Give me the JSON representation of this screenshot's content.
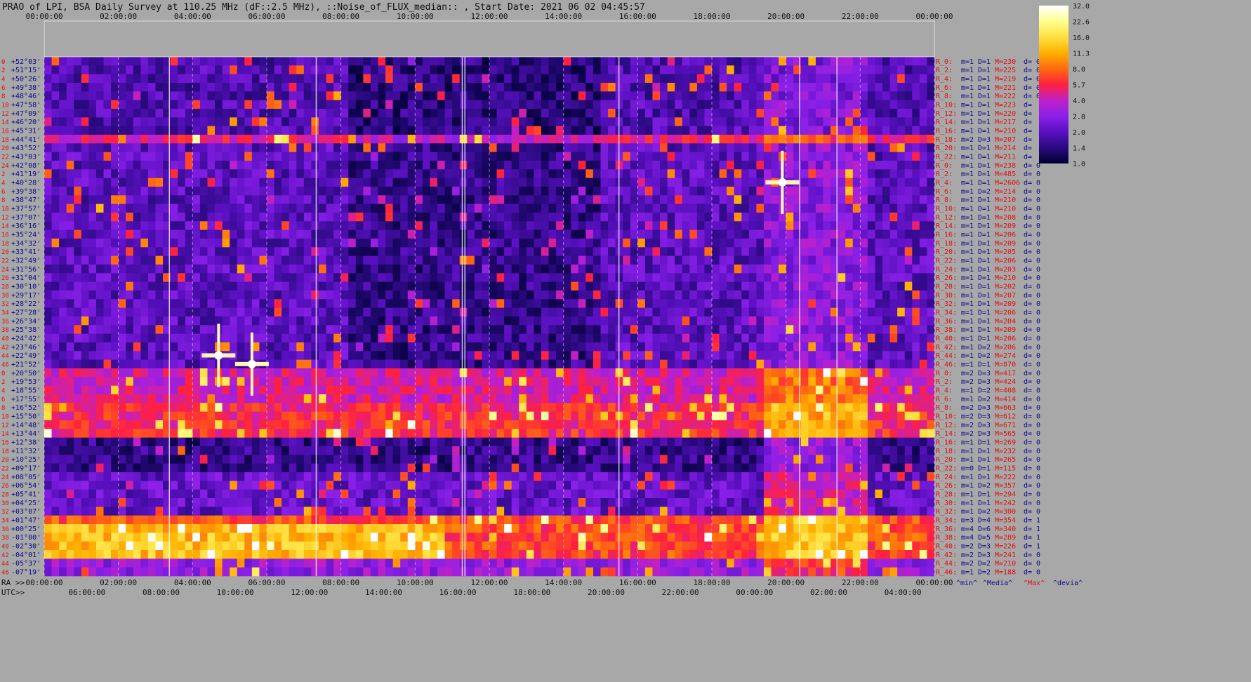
{
  "chart_data": {
    "type": "heatmap",
    "title": "PRAO of LPI, BSA Daily Survey at 110.25 MHz (dF::2.5 MHz), ::Noise_of_FLUX_median:: , Start Date: 2021 06 02 04:45:57",
    "x_top_ticks": [
      "00:00:00",
      "02:00:00",
      "04:00:00",
      "06:00:00",
      "08:00:00",
      "10:00:00",
      "12:00:00",
      "14:00:00",
      "16:00:00",
      "18:00:00",
      "20:00:00",
      "22:00:00",
      "00:00:00"
    ],
    "x_ra_prefix": "RA >>",
    "x_ra_ticks": [
      "00:00:00",
      "02:00:00",
      "04:00:00",
      "06:00:00",
      "08:00:00",
      "10:00:00",
      "12:00:00",
      "14:00:00",
      "16:00:00",
      "18:00:00",
      "20:00:00",
      "22:00:00",
      "00:00:00"
    ],
    "x_utc_prefix": "UTC>>",
    "x_utc_ticks": [
      "06:00:00",
      "08:00:00",
      "10:00:00",
      "12:00:00",
      "14:00:00",
      "16:00:00",
      "18:00:00",
      "20:00:00",
      "22:00:00",
      "00:00:00",
      "02:00:00",
      "04:00:00"
    ],
    "y_ticks": [
      {
        "n": "0",
        "dec": "+52°03'"
      },
      {
        "n": "2",
        "dec": "+51°15'"
      },
      {
        "n": "4",
        "dec": "+50°26'"
      },
      {
        "n": "6",
        "dec": "+49°38'"
      },
      {
        "n": "8",
        "dec": "+48°46'"
      },
      {
        "n": "10",
        "dec": "+47°58'"
      },
      {
        "n": "12",
        "dec": "+47°09'"
      },
      {
        "n": "14",
        "dec": "+46°20'"
      },
      {
        "n": "16",
        "dec": "+45°31'"
      },
      {
        "n": "18",
        "dec": "+44°41'"
      },
      {
        "n": "20",
        "dec": "+43°52'"
      },
      {
        "n": "22",
        "dec": "+43°03'"
      },
      {
        "n": "24",
        "dec": "+42°08'"
      },
      {
        "n": "2",
        "dec": "+41°19'"
      },
      {
        "n": "4",
        "dec": "+40°28'"
      },
      {
        "n": "6",
        "dec": "+39°38'"
      },
      {
        "n": "8",
        "dec": "+38°47'"
      },
      {
        "n": "10",
        "dec": "+37°57'"
      },
      {
        "n": "12",
        "dec": "+37°07'"
      },
      {
        "n": "14",
        "dec": "+36°16'"
      },
      {
        "n": "16",
        "dec": "+35°24'"
      },
      {
        "n": "18",
        "dec": "+34°32'"
      },
      {
        "n": "20",
        "dec": "+33°41'"
      },
      {
        "n": "22",
        "dec": "+32°49'"
      },
      {
        "n": "24",
        "dec": "+31°56'"
      },
      {
        "n": "26",
        "dec": "+31°04'"
      },
      {
        "n": "28",
        "dec": "+30°10'"
      },
      {
        "n": "30",
        "dec": "+29°17'"
      },
      {
        "n": "32",
        "dec": "+28°22'"
      },
      {
        "n": "34",
        "dec": "+27°28'"
      },
      {
        "n": "36",
        "dec": "+26°34'"
      },
      {
        "n": "38",
        "dec": "+25°38'"
      },
      {
        "n": "40",
        "dec": "+24°42'"
      },
      {
        "n": "42",
        "dec": "+23°46'"
      },
      {
        "n": "44",
        "dec": "+22°49'"
      },
      {
        "n": "46",
        "dec": "+21°52'"
      },
      {
        "n": "0",
        "dec": "+20°50'"
      },
      {
        "n": "2",
        "dec": "+19°53'"
      },
      {
        "n": "4",
        "dec": "+18°55'"
      },
      {
        "n": "6",
        "dec": "+17°55'"
      },
      {
        "n": "8",
        "dec": "+16°52'"
      },
      {
        "n": "10",
        "dec": "+15°50'"
      },
      {
        "n": "12",
        "dec": "+14°48'"
      },
      {
        "n": "14",
        "dec": "+13°44'"
      },
      {
        "n": "16",
        "dec": "+12°38'"
      },
      {
        "n": "18",
        "dec": "+11°32'"
      },
      {
        "n": "20",
        "dec": "+10°25'"
      },
      {
        "n": "22",
        "dec": "+09°17'"
      },
      {
        "n": "24",
        "dec": "+08°05'"
      },
      {
        "n": "26",
        "dec": "+06°54'"
      },
      {
        "n": "28",
        "dec": "+05°41'"
      },
      {
        "n": "30",
        "dec": "+04°25'"
      },
      {
        "n": "32",
        "dec": "+03°07'"
      },
      {
        "n": "34",
        "dec": "+01°47'"
      },
      {
        "n": "36",
        "dec": "+00°25'"
      },
      {
        "n": "38",
        "dec": "-01°00'"
      },
      {
        "n": "40",
        "dec": "-02°30'"
      },
      {
        "n": "42",
        "dec": "-04°01'"
      },
      {
        "n": "44",
        "dec": "-05°37'"
      },
      {
        "n": "46",
        "dec": "-07°19'"
      }
    ],
    "right_rows": [
      {
        "r": "R_0:",
        "m": "m=1",
        "D": "D=1",
        "M": "M=230",
        "d": "d= 0"
      },
      {
        "r": "R_2:",
        "m": "m=1",
        "D": "D=1",
        "M": "M=225",
        "d": "d= 0"
      },
      {
        "r": "R_4:",
        "m": "m=1",
        "D": "D=1",
        "M": "M=219",
        "d": "d= 0"
      },
      {
        "r": "R_6:",
        "m": "m=1",
        "D": "D=1",
        "M": "M=221",
        "d": "d= 0"
      },
      {
        "r": "R_8:",
        "m": "m=1",
        "D": "D=1",
        "M": "M=222",
        "d": "d= 0"
      },
      {
        "r": "R_10:",
        "m": "m=1",
        "D": "D=1",
        "M": "M=223",
        "d": "d="
      },
      {
        "r": "R_12:",
        "m": "m=1",
        "D": "D=1",
        "M": "M=220",
        "d": "d="
      },
      {
        "r": "R_14:",
        "m": "m=1",
        "D": "D=1",
        "M": "M=217",
        "d": "d="
      },
      {
        "r": "R_16:",
        "m": "m=1",
        "D": "D=1",
        "M": "M=210",
        "d": "d="
      },
      {
        "r": "R_18:",
        "m": "m=2",
        "D": "D=3",
        "M": "M=207",
        "d": "d="
      },
      {
        "r": "R_20:",
        "m": "m=1",
        "D": "D=1",
        "M": "M=214",
        "d": "d="
      },
      {
        "r": "R_22:",
        "m": "m=1",
        "D": "D=1",
        "M": "M=211",
        "d": "d="
      },
      {
        "r": "R_0:",
        "m": "m=1",
        "D": "D=1",
        "M": "M=238",
        "d": "d= 0"
      },
      {
        "r": "R_2:",
        "m": "m=1",
        "D": "D=1",
        "M": "M=485",
        "d": "d= 0"
      },
      {
        "r": "R_4:",
        "m": "m=1",
        "D": "D=1",
        "M": "M=2606",
        "d": "d= 0"
      },
      {
        "r": "R_6:",
        "m": "m=1",
        "D": "D=2",
        "M": "M=214",
        "d": "d= 0"
      },
      {
        "r": "R_8:",
        "m": "m=1",
        "D": "D=1",
        "M": "M=210",
        "d": "d= 0"
      },
      {
        "r": "R_10:",
        "m": "m=1",
        "D": "D=1",
        "M": "M=210",
        "d": "d= 0"
      },
      {
        "r": "R_12:",
        "m": "m=1",
        "D": "D=1",
        "M": "M=208",
        "d": "d= 0"
      },
      {
        "r": "R_14:",
        "m": "m=1",
        "D": "D=1",
        "M": "M=209",
        "d": "d= 0"
      },
      {
        "r": "R_16:",
        "m": "m=1",
        "D": "D=1",
        "M": "M=206",
        "d": "d= 0"
      },
      {
        "r": "R_18:",
        "m": "m=1",
        "D": "D=1",
        "M": "M=209",
        "d": "d= 0"
      },
      {
        "r": "R_20:",
        "m": "m=1",
        "D": "D=1",
        "M": "M=205",
        "d": "d= 0"
      },
      {
        "r": "R_22:",
        "m": "m=1",
        "D": "D=1",
        "M": "M=206",
        "d": "d= 0"
      },
      {
        "r": "R_24:",
        "m": "m=1",
        "D": "D=1",
        "M": "M=203",
        "d": "d= 0"
      },
      {
        "r": "R_26:",
        "m": "m=1",
        "D": "D=1",
        "M": "M=210",
        "d": "d= 0"
      },
      {
        "r": "R_28:",
        "m": "m=1",
        "D": "D=1",
        "M": "M=202",
        "d": "d= 0"
      },
      {
        "r": "R_30:",
        "m": "m=1",
        "D": "D=1",
        "M": "M=207",
        "d": "d= 0"
      },
      {
        "r": "R_32:",
        "m": "m=1",
        "D": "D=1",
        "M": "M=209",
        "d": "d= 0"
      },
      {
        "r": "R_34:",
        "m": "m=1",
        "D": "D=1",
        "M": "M=206",
        "d": "d= 0"
      },
      {
        "r": "R_36:",
        "m": "m=1",
        "D": "D=1",
        "M": "M=204",
        "d": "d= 0"
      },
      {
        "r": "R_38:",
        "m": "m=1",
        "D": "D=1",
        "M": "M=209",
        "d": "d= 0"
      },
      {
        "r": "R_40:",
        "m": "m=1",
        "D": "D=1",
        "M": "M=206",
        "d": "d= 0"
      },
      {
        "r": "R_42:",
        "m": "m=1",
        "D": "D=2",
        "M": "M=206",
        "d": "d= 0"
      },
      {
        "r": "R_44:",
        "m": "m=1",
        "D": "D=2",
        "M": "M=274",
        "d": "d= 0"
      },
      {
        "r": "R_46:",
        "m": "m=1",
        "D": "D=1",
        "M": "M=870",
        "d": "d= 0"
      },
      {
        "r": "R_0:",
        "m": "m=2",
        "D": "D=3",
        "M": "M=417",
        "d": "d= 0"
      },
      {
        "r": "R_2:",
        "m": "m=2",
        "D": "D=3",
        "M": "M=424",
        "d": "d= 0"
      },
      {
        "r": "R_4:",
        "m": "m=1",
        "D": "D=2",
        "M": "M=408",
        "d": "d= 0"
      },
      {
        "r": "R_6:",
        "m": "m=1",
        "D": "D=2",
        "M": "M=414",
        "d": "d= 0"
      },
      {
        "r": "R_8:",
        "m": "m=2",
        "D": "D=3",
        "M": "M=663",
        "d": "d= 0"
      },
      {
        "r": "R_10:",
        "m": "m=2",
        "D": "D=3",
        "M": "M=612",
        "d": "d= 0"
      },
      {
        "r": "R_12:",
        "m": "m=2",
        "D": "D=3",
        "M": "M=671",
        "d": "d= 0"
      },
      {
        "r": "R_14:",
        "m": "m=2",
        "D": "D=3",
        "M": "M=565",
        "d": "d= 0"
      },
      {
        "r": "R_16:",
        "m": "m=1",
        "D": "D=1",
        "M": "M=269",
        "d": "d= 0"
      },
      {
        "r": "R_18:",
        "m": "m=1",
        "D": "D=1",
        "M": "M=232",
        "d": "d= 0"
      },
      {
        "r": "R_20:",
        "m": "m=1",
        "D": "D=1",
        "M": "M=265",
        "d": "d= 0"
      },
      {
        "r": "R_22:",
        "m": "m=0",
        "D": "D=1",
        "M": "M=115",
        "d": "d= 0"
      },
      {
        "r": "R_24:",
        "m": "m=1",
        "D": "D=1",
        "M": "M=222",
        "d": "d= 0"
      },
      {
        "r": "R_26:",
        "m": "m=1",
        "D": "D=2",
        "M": "M=357",
        "d": "d= 0"
      },
      {
        "r": "R_28:",
        "m": "m=1",
        "D": "D=1",
        "M": "M=294",
        "d": "d= 0"
      },
      {
        "r": "R_30:",
        "m": "m=1",
        "D": "D=1",
        "M": "M=242",
        "d": "d= 0"
      },
      {
        "r": "R_32:",
        "m": "m=1",
        "D": "D=2",
        "M": "M=300",
        "d": "d= 0"
      },
      {
        "r": "R_34:",
        "m": "m=3",
        "D": "D=4",
        "M": "M=354",
        "d": "d= 1"
      },
      {
        "r": "R_36:",
        "m": "m=4",
        "D": "D=6",
        "M": "M=340",
        "d": "d= 1"
      },
      {
        "r": "R_38:",
        "m": "m=4",
        "D": "D=5",
        "M": "M=289",
        "d": "d= 1"
      },
      {
        "r": "R_40:",
        "m": "m=2",
        "D": "D=3",
        "M": "M=226",
        "d": "d= 1"
      },
      {
        "r": "R_42:",
        "m": "m=2",
        "D": "D=3",
        "M": "M=241",
        "d": "d= 0"
      },
      {
        "r": "R_44:",
        "m": "m=2",
        "D": "D=2",
        "M": "M=210",
        "d": "d= 0"
      },
      {
        "r": "R_46:",
        "m": "m=1",
        "D": "D=2",
        "M": "M=188",
        "d": "d= 0"
      }
    ],
    "bottom_legend": [
      "^min^",
      "^Media^",
      "^Max^",
      "^devia^"
    ],
    "colorbar": {
      "labels": [
        "32.0",
        "22.6",
        "16.0",
        "11.3",
        "8.0",
        "5.7",
        "4.0",
        "2.8",
        "2.0",
        "1.4",
        "1.0"
      ],
      "stops": [
        "#000033",
        "#2a0a80",
        "#5a10c0",
        "#8a20e8",
        "#c020c8",
        "#ff2040",
        "#ff6a10",
        "#ffb000",
        "#ffe040",
        "#ffff90",
        "#ffffff"
      ]
    },
    "colors": {
      "background": "#a8a8a8",
      "label_red": "#e01010",
      "label_blue": "#0a0a8a",
      "text": "#111111"
    },
    "bright_sources": [
      {
        "ra_hours": 4.7,
        "row": 34
      },
      {
        "ra_hours": 19.9,
        "row": 14
      },
      {
        "ra_hours": 5.6,
        "row": 35
      }
    ]
  }
}
